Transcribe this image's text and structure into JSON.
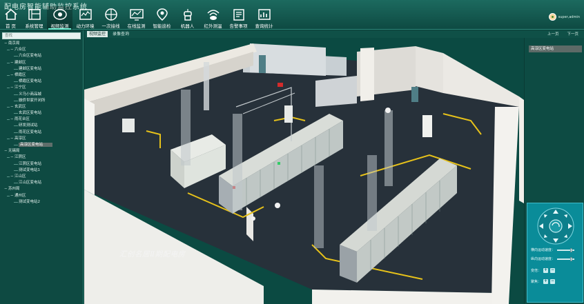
{
  "app": {
    "title": "配电房智能辅助监控系统"
  },
  "nav": [
    {
      "label": "首  页",
      "icon": "home-icon"
    },
    {
      "label": "系统管理",
      "icon": "manage-icon"
    },
    {
      "label": "视频监测",
      "icon": "camera-icon"
    },
    {
      "label": "动力环境",
      "icon": "power-env-icon"
    },
    {
      "label": "一次接线",
      "icon": "wiring-icon"
    },
    {
      "label": "在线监测",
      "icon": "monitor-icon"
    },
    {
      "label": "智能巡检",
      "icon": "inspection-icon"
    },
    {
      "label": "机器人",
      "icon": "robot-icon"
    },
    {
      "label": "红外测温",
      "icon": "infrared-icon"
    },
    {
      "label": "告警事项",
      "icon": "alarm-icon"
    },
    {
      "label": "查询统计",
      "icon": "query-icon"
    }
  ],
  "nav_active_index": 2,
  "user": {
    "name": "super,admin"
  },
  "sidebar": {
    "search_placeholder": "查找",
    "tree": [
      {
        "level": 0,
        "label": "南京局",
        "toggle": "−"
      },
      {
        "level": 1,
        "label": "六合区",
        "toggle": "−"
      },
      {
        "level": 2,
        "label": "六合区变电站"
      },
      {
        "level": 1,
        "label": "建邺区",
        "toggle": "−"
      },
      {
        "level": 2,
        "label": "建邺区变电站"
      },
      {
        "level": 1,
        "label": "栖霞区",
        "toggle": "−"
      },
      {
        "level": 2,
        "label": "栖霞区变电站"
      },
      {
        "level": 1,
        "label": "江宁区",
        "toggle": "−"
      },
      {
        "level": 2,
        "label": "义乌小商品城"
      },
      {
        "level": 2,
        "label": "融侨世家开闭所"
      },
      {
        "level": 1,
        "label": "玄武区",
        "toggle": "−"
      },
      {
        "level": 2,
        "label": "玄武区变电站"
      },
      {
        "level": 1,
        "label": "雨花台区",
        "toggle": "−"
      },
      {
        "level": 2,
        "label": "研发测试站"
      },
      {
        "level": 2,
        "label": "雨花区变电站"
      },
      {
        "level": 1,
        "label": "高淳区",
        "toggle": "−"
      },
      {
        "level": 2,
        "label": "高淳区变电站",
        "selected": true
      },
      {
        "level": 0,
        "label": "无锡局",
        "toggle": "−"
      },
      {
        "level": 1,
        "label": "江阴区",
        "toggle": "−"
      },
      {
        "level": 2,
        "label": "江阴区变电站"
      },
      {
        "level": 2,
        "label": "测试变电站1"
      },
      {
        "level": 1,
        "label": "江山区",
        "toggle": "−"
      },
      {
        "level": 2,
        "label": "江山区变电站"
      },
      {
        "level": 0,
        "label": "苏州局",
        "toggle": "−"
      },
      {
        "level": 1,
        "label": "通州区",
        "toggle": "−"
      },
      {
        "level": 2,
        "label": "测试变电站2"
      }
    ]
  },
  "tabs": [
    {
      "label": "视频监控",
      "active": true
    },
    {
      "label": "录像查询",
      "active": false
    }
  ],
  "page_nav": {
    "prev": "上一页",
    "next": "下一页"
  },
  "viewport": {
    "watermark": "汇创名居Ⅱ期配电房"
  },
  "right_panel": {
    "room": "高淳区变电站",
    "ptz": {
      "h_speed_label": "横向运动速度：",
      "v_speed_label": "纵向运动速度：",
      "h_speed": 0.85,
      "v_speed": 0.85,
      "zoom_label": "变倍：",
      "focus_label": "聚焦：",
      "plus": "+",
      "minus": "−"
    }
  },
  "colors": {
    "accent": "#6ff0d4",
    "header": "#1c6a5f",
    "panel": "#0a8c99"
  }
}
